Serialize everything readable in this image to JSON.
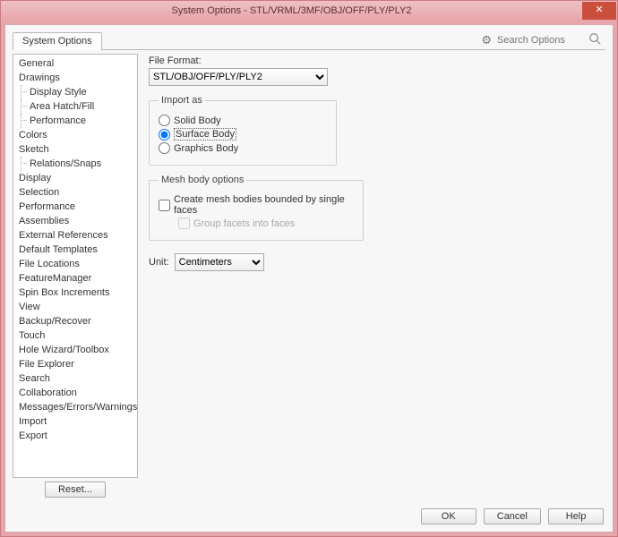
{
  "window": {
    "title": "System Options - STL/VRML/3MF/OBJ/OFF/PLY/PLY2",
    "close": "✕"
  },
  "tabs": {
    "system_options": "System Options"
  },
  "search": {
    "placeholder": "Search Options"
  },
  "nav": {
    "items": [
      {
        "label": "General",
        "child": false
      },
      {
        "label": "Drawings",
        "child": false
      },
      {
        "label": "Display Style",
        "child": true
      },
      {
        "label": "Area Hatch/Fill",
        "child": true
      },
      {
        "label": "Performance",
        "child": true
      },
      {
        "label": "Colors",
        "child": false
      },
      {
        "label": "Sketch",
        "child": false
      },
      {
        "label": "Relations/Snaps",
        "child": true
      },
      {
        "label": "Display",
        "child": false
      },
      {
        "label": "Selection",
        "child": false
      },
      {
        "label": "Performance",
        "child": false
      },
      {
        "label": "Assemblies",
        "child": false
      },
      {
        "label": "External References",
        "child": false
      },
      {
        "label": "Default Templates",
        "child": false
      },
      {
        "label": "File Locations",
        "child": false
      },
      {
        "label": "FeatureManager",
        "child": false
      },
      {
        "label": "Spin Box Increments",
        "child": false
      },
      {
        "label": "View",
        "child": false
      },
      {
        "label": "Backup/Recover",
        "child": false
      },
      {
        "label": "Touch",
        "child": false
      },
      {
        "label": "Hole Wizard/Toolbox",
        "child": false
      },
      {
        "label": "File Explorer",
        "child": false
      },
      {
        "label": "Search",
        "child": false
      },
      {
        "label": "Collaboration",
        "child": false
      },
      {
        "label": "Messages/Errors/Warnings",
        "child": false
      },
      {
        "label": "Import",
        "child": false
      },
      {
        "label": "Export",
        "child": false
      }
    ],
    "reset": "Reset..."
  },
  "content": {
    "file_format_label": "File Format:",
    "file_format_value": "STL/OBJ/OFF/PLY/PLY2",
    "import_as": {
      "legend": "Import as",
      "solid": "Solid Body",
      "surface": "Surface Body",
      "graphics": "Graphics Body",
      "selected": "surface"
    },
    "mesh": {
      "legend": "Mesh body options",
      "create": "Create mesh bodies bounded by single faces",
      "group": "Group facets into faces"
    },
    "unit_label": "Unit:",
    "unit_value": "Centimeters"
  },
  "footer": {
    "ok": "OK",
    "cancel": "Cancel",
    "help": "Help"
  }
}
